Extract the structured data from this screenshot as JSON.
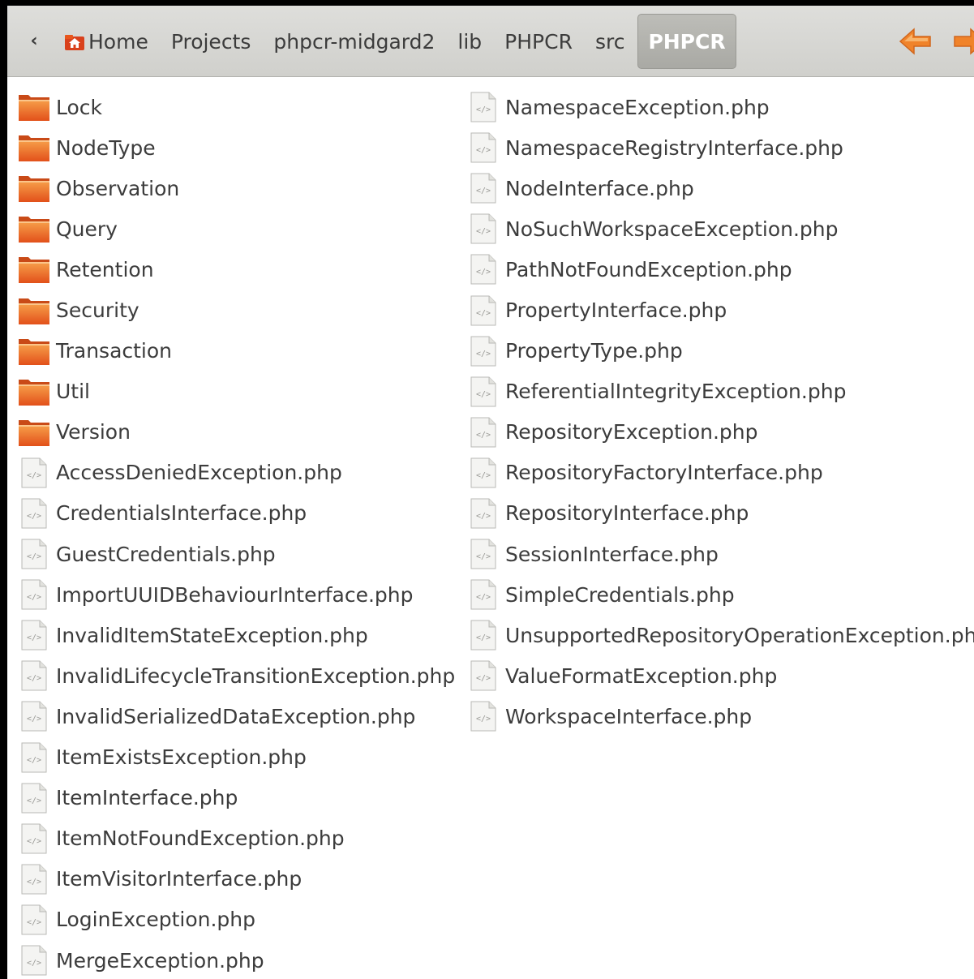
{
  "toolbar": {
    "back_glyph": "‹",
    "breadcrumbs": [
      "Home",
      "Projects",
      "phpcr-midgard2",
      "lib",
      "PHPCR",
      "src",
      "PHPCR"
    ],
    "active_index": 6
  },
  "files": {
    "column1": [
      {
        "name": "Lock",
        "type": "folder"
      },
      {
        "name": "NodeType",
        "type": "folder"
      },
      {
        "name": "Observation",
        "type": "folder"
      },
      {
        "name": "Query",
        "type": "folder"
      },
      {
        "name": "Retention",
        "type": "folder"
      },
      {
        "name": "Security",
        "type": "folder"
      },
      {
        "name": "Transaction",
        "type": "folder"
      },
      {
        "name": "Util",
        "type": "folder"
      },
      {
        "name": "Version",
        "type": "folder"
      },
      {
        "name": "AccessDeniedException.php",
        "type": "php"
      },
      {
        "name": "CredentialsInterface.php",
        "type": "php"
      },
      {
        "name": "GuestCredentials.php",
        "type": "php"
      },
      {
        "name": "ImportUUIDBehaviourInterface.php",
        "type": "php"
      },
      {
        "name": "InvalidItemStateException.php",
        "type": "php"
      },
      {
        "name": "InvalidLifecycleTransitionException.php",
        "type": "php"
      },
      {
        "name": "InvalidSerializedDataException.php",
        "type": "php"
      },
      {
        "name": "ItemExistsException.php",
        "type": "php"
      },
      {
        "name": "ItemInterface.php",
        "type": "php"
      },
      {
        "name": "ItemNotFoundException.php",
        "type": "php"
      },
      {
        "name": "ItemVisitorInterface.php",
        "type": "php"
      },
      {
        "name": "LoginException.php",
        "type": "php"
      },
      {
        "name": "MergeException.php",
        "type": "php"
      }
    ],
    "column2": [
      {
        "name": "NamespaceException.php",
        "type": "php"
      },
      {
        "name": "NamespaceRegistryInterface.php",
        "type": "php"
      },
      {
        "name": "NodeInterface.php",
        "type": "php"
      },
      {
        "name": "NoSuchWorkspaceException.php",
        "type": "php"
      },
      {
        "name": "PathNotFoundException.php",
        "type": "php"
      },
      {
        "name": "PropertyInterface.php",
        "type": "php"
      },
      {
        "name": "PropertyType.php",
        "type": "php"
      },
      {
        "name": "ReferentialIntegrityException.php",
        "type": "php"
      },
      {
        "name": "RepositoryException.php",
        "type": "php"
      },
      {
        "name": "RepositoryFactoryInterface.php",
        "type": "php"
      },
      {
        "name": "RepositoryInterface.php",
        "type": "php"
      },
      {
        "name": "SessionInterface.php",
        "type": "php"
      },
      {
        "name": "SimpleCredentials.php",
        "type": "php"
      },
      {
        "name": "UnsupportedRepositoryOperationException.php",
        "type": "php"
      },
      {
        "name": "ValueFormatException.php",
        "type": "php"
      },
      {
        "name": "WorkspaceInterface.php",
        "type": "php"
      }
    ]
  },
  "colors": {
    "folder": "#e8561c",
    "folder_light": "#f7a04a",
    "nav_arrow": "#f0832a",
    "text": "#3c3c3c"
  },
  "icons": {
    "folder": "folder-icon",
    "php": "php-file-icon",
    "home": "home-icon",
    "back": "back-icon",
    "nav_back": "nav-back-arrow-icon",
    "nav_forward": "nav-forward-arrow-icon"
  }
}
